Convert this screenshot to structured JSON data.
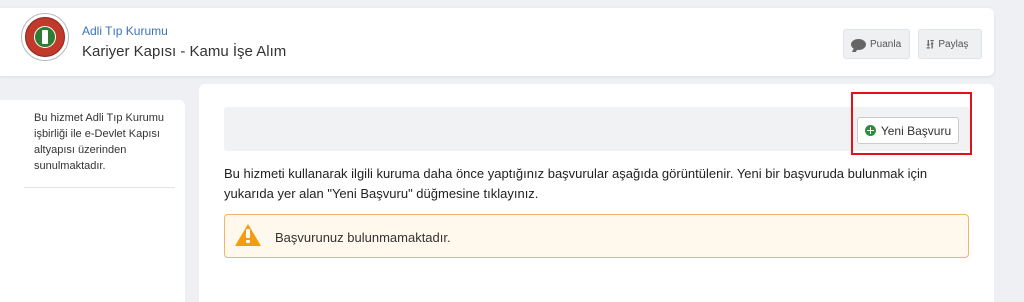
{
  "header": {
    "institution": "Adli Tıp Kurumu",
    "service_title": "Kariyer Kapısı - Kamu İşe Alım",
    "rate_label": "Puanla",
    "share_label": "Paylaş",
    "logo_icon": "adli-tip-kurumu-seal"
  },
  "sidebar": {
    "text": "Bu hizmet Adli Tıp Kurumu işbirliği ile e-Devlet Kapısı altyapısı üzerinden sunulmaktadır."
  },
  "main": {
    "new_application_label": "Yeni Başvuru",
    "info_text": "Bu hizmeti kullanarak ilgili kuruma daha önce yaptığınız başvurular aşağıda görüntülenir. Yeni bir başvuruda bulunmak için yukarıda yer alan \"Yeni Başvuru\" düğmesine tıklayınız.",
    "alert_text": "Başvurunuz bulunmamaktadır."
  },
  "colors": {
    "link_blue": "#3b73b9",
    "plus_green": "#2e8b3e",
    "warning_orange": "#f39c12",
    "highlight_red": "#e0121a"
  }
}
